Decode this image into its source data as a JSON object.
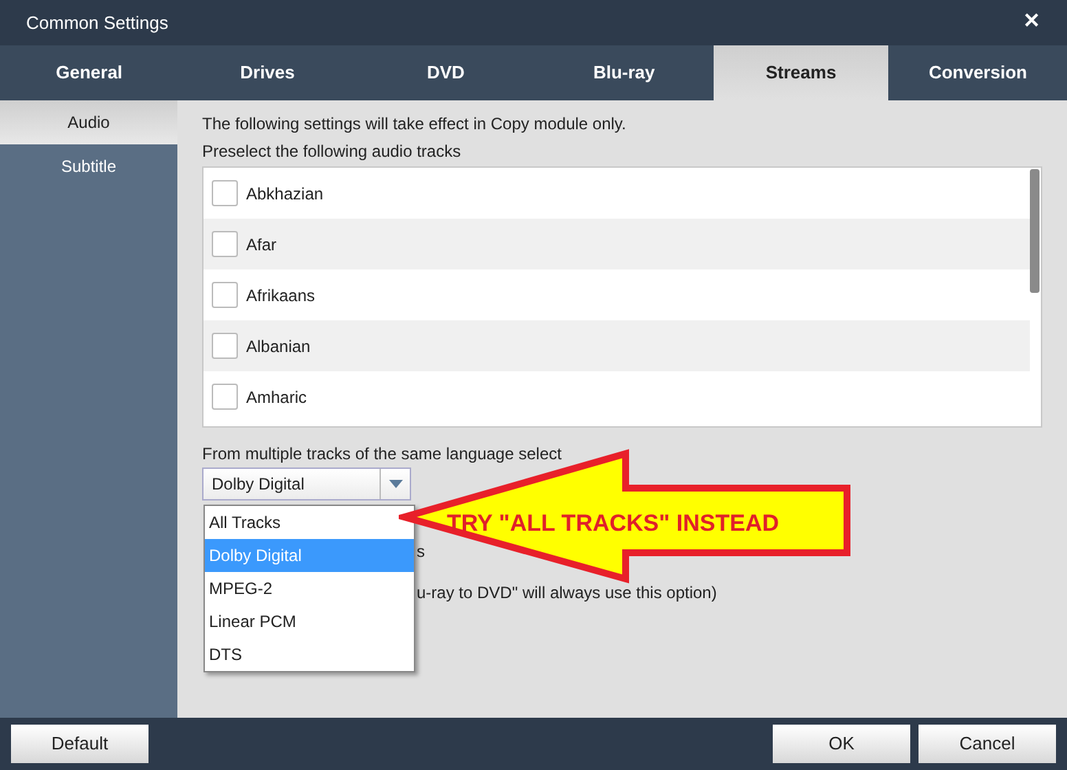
{
  "window": {
    "title": "Common Settings",
    "close": "✕"
  },
  "tabs": [
    {
      "label": "General",
      "selected": false
    },
    {
      "label": "Drives",
      "selected": false
    },
    {
      "label": "DVD",
      "selected": false
    },
    {
      "label": "Blu-ray",
      "selected": false
    },
    {
      "label": "Streams",
      "selected": true
    },
    {
      "label": "Conversion",
      "selected": false
    }
  ],
  "sidebar": {
    "items": [
      {
        "label": "Audio",
        "selected": true
      },
      {
        "label": "Subtitle",
        "selected": false
      }
    ]
  },
  "notice": "The following settings will take effect in Copy module only.",
  "tracks_label": "Preselect the following audio tracks",
  "tracks": [
    {
      "label": "Abkhazian",
      "checked": false
    },
    {
      "label": "Afar",
      "checked": false
    },
    {
      "label": "Afrikaans",
      "checked": false
    },
    {
      "label": "Albanian",
      "checked": false
    },
    {
      "label": "Amharic",
      "checked": false
    }
  ],
  "select_label": "From multiple tracks of the same language select",
  "dropdown": {
    "value": "Dolby Digital",
    "options": [
      {
        "label": "All Tracks",
        "selected": false
      },
      {
        "label": "Dolby Digital",
        "selected": true
      },
      {
        "label": "MPEG-2",
        "selected": false
      },
      {
        "label": "Linear PCM",
        "selected": false
      },
      {
        "label": "DTS",
        "selected": false
      }
    ]
  },
  "hidden_lines": [
    "s",
    "u-ray to DVD\" will always use this option)"
  ],
  "annotation": "TRY \"ALL TRACKS\" INSTEAD",
  "buttons": {
    "default": "Default",
    "ok": "OK",
    "cancel": "Cancel"
  }
}
